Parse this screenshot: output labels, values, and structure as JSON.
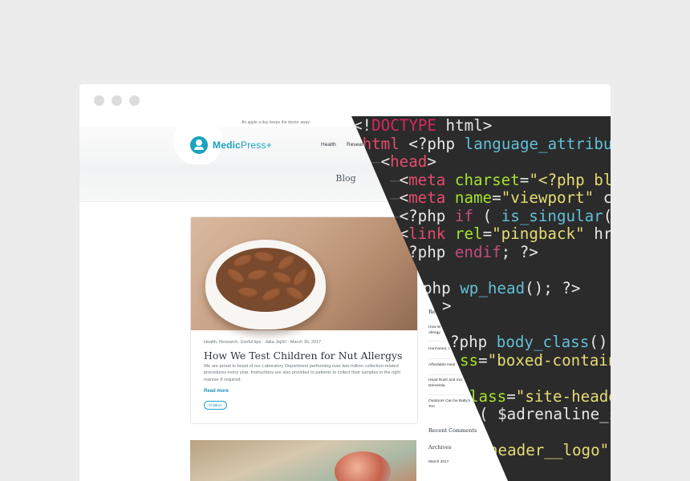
{
  "website": {
    "tagline": "An apple a day keeps the doctor away.",
    "brand": {
      "primary": "Medic",
      "secondary": "Press+"
    },
    "nav": [
      "Health",
      "Research"
    ],
    "page_title": "Blog",
    "post": {
      "meta": "Health, Research, Useful tips  ·  Jaka Jejčič  ·  March 30, 2017",
      "title": "How We Test Children for Nut Allergys",
      "excerpt": "We are proud to boast of our Laboratory Department performing over two-million collection-related procedures every year. Instructions are also provided to patients to collect their samples in the right manner if required.",
      "read_more": "Read more",
      "tag": "Children"
    },
    "sidebar": {
      "recent_posts_heading": "Re",
      "recent_posts": [
        "How W\nAllergy",
        "Hormones, I",
        "Affordable Heal",
        "Head Rush and Incr\nDementia",
        "Outdoors Can be Baby's\nToo"
      ],
      "recent_comments_heading": "Recent Comments",
      "archives_heading": "Archives",
      "archive_month": "March 2017"
    },
    "brand_color": "#1aa1c3"
  },
  "code_editor": {
    "background": "#2b2b2b",
    "lines": [
      "<!DOCTYPE html>",
      "<html <?php language_attributes",
      "<head>",
      "<meta charset=\"<?php bl",
      "<meta name=\"viewport\" c",
      "<?php if ( is_singular(",
      "<link rel=\"pingback\" hr",
      "<?php endif; ?>",
      "php wp_head(); ?>",
      ">",
      "?php body_class();",
      "ss=\"boxed-contain",
      "lass=\"site-heade",
      "( $adrenaline_s",
      "header__logo\""
    ]
  }
}
